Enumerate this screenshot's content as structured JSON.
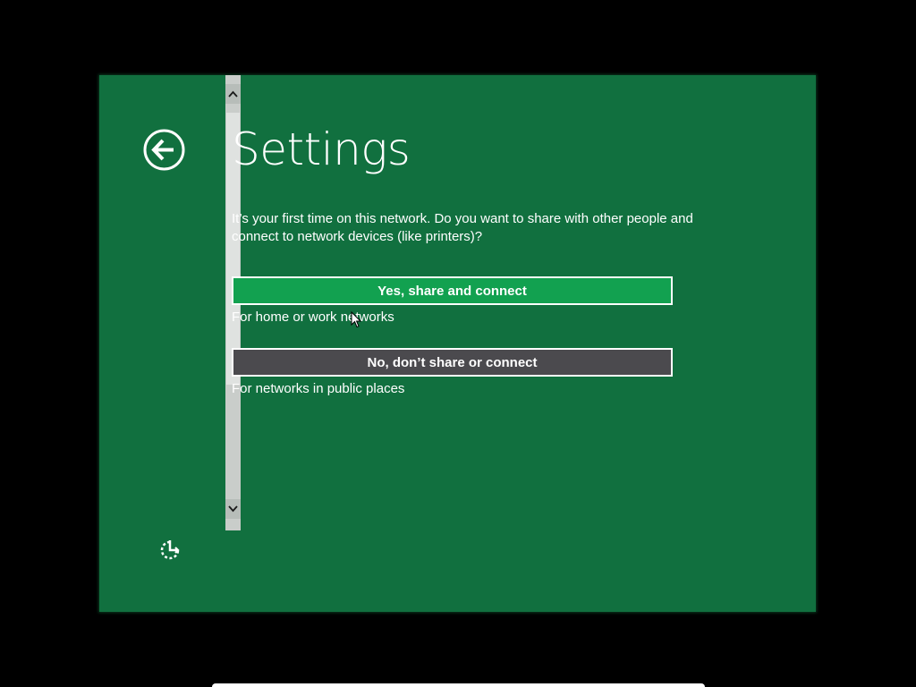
{
  "header": {
    "title": "Settings"
  },
  "prompt": {
    "text": "It’s your first time on this network. Do you want to share with other people and connect to network devices (like printers)?"
  },
  "options": {
    "yes": {
      "label": "Yes, share and connect",
      "hint": "For home or work networks"
    },
    "no": {
      "label": "No, don’t share or connect",
      "hint": "For networks in public places"
    }
  },
  "icons": {
    "back": "back-arrow-icon",
    "ease_of_access": "ease-of-access-icon",
    "scroll_up": "chevron-up-icon",
    "scroll_down": "chevron-down-icon"
  },
  "colors": {
    "background": "#11703f",
    "yes_button": "#12a150",
    "no_button": "#4b4a4e",
    "text": "#ffffff"
  }
}
